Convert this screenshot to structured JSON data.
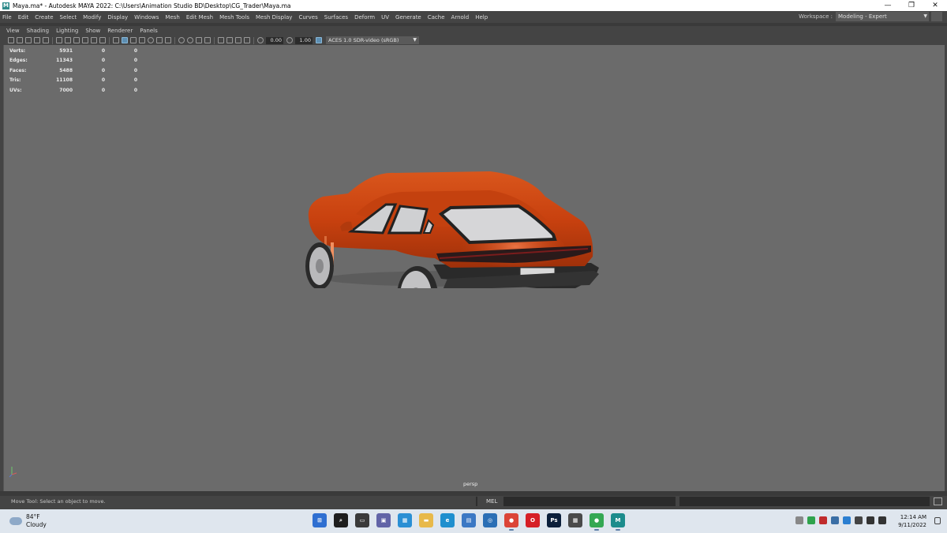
{
  "window": {
    "title": "Maya.ma* - Autodesk MAYA 2022: C:\\Users\\Animation Studio BD\\Desktop\\CG_Trader\\Maya.ma",
    "logo": "M",
    "minimize": "—",
    "maximize": "❐",
    "close": "✕"
  },
  "menubar": {
    "items": [
      "File",
      "Edit",
      "Create",
      "Select",
      "Modify",
      "Display",
      "Windows",
      "Mesh",
      "Edit Mesh",
      "Mesh Tools",
      "Mesh Display",
      "Curves",
      "Surfaces",
      "Deform",
      "UV",
      "Generate",
      "Cache",
      "Arnold",
      "Help"
    ],
    "workspace_label": "Workspace :",
    "workspace_value": "Modeling - Expert"
  },
  "panel": {
    "menus": [
      "View",
      "Shading",
      "Lighting",
      "Show",
      "Renderer",
      "Panels"
    ],
    "exposure": "0.00",
    "gamma": "1.00",
    "color_space": "ACES 1.0 SDR-video (sRGB)"
  },
  "hud": {
    "rows": [
      {
        "label": "Verts:",
        "values": [
          "5931",
          "0",
          "0"
        ]
      },
      {
        "label": "Edges:",
        "values": [
          "11343",
          "0",
          "0"
        ]
      },
      {
        "label": "Faces:",
        "values": [
          "5488",
          "0",
          "0"
        ]
      },
      {
        "label": "Tris:",
        "values": [
          "11108",
          "0",
          "0"
        ]
      },
      {
        "label": "UVs:",
        "values": [
          "7000",
          "0",
          "0"
        ]
      }
    ]
  },
  "viewport": {
    "camera": "persp",
    "background": "#6b6b6b",
    "car_color": "#c8410f"
  },
  "helpline": {
    "message": "Move Tool: Select an object to move.",
    "mel_label": "MEL"
  },
  "taskbar": {
    "temperature": "84°F",
    "condition": "Cloudy",
    "time": "12:14 AM",
    "date": "9/11/2022",
    "apps": [
      {
        "name": "windows-start-icon",
        "color": "#2f6fd1",
        "glyph": "⊞",
        "active": false
      },
      {
        "name": "search-icon",
        "color": "#1e1e1e",
        "glyph": "⌕",
        "active": false
      },
      {
        "name": "task-view-icon",
        "color": "#3a3a3a",
        "glyph": "▭",
        "active": false
      },
      {
        "name": "teams-chat-icon",
        "color": "#6264a7",
        "glyph": "▣",
        "active": false
      },
      {
        "name": "photos-icon",
        "color": "#2a8fd4",
        "glyph": "▦",
        "active": false
      },
      {
        "name": "file-explorer-icon",
        "color": "#e8b94a",
        "glyph": "▬",
        "active": false
      },
      {
        "name": "edge-icon",
        "color": "#1f8fce",
        "glyph": "e",
        "active": false
      },
      {
        "name": "store-icon",
        "color": "#3b78c4",
        "glyph": "▤",
        "active": false
      },
      {
        "name": "cortana-icon",
        "color": "#2b6fb5",
        "glyph": "◎",
        "active": false
      },
      {
        "name": "chrome-icon",
        "color": "#db4437",
        "glyph": "●",
        "active": true
      },
      {
        "name": "opera-icon",
        "color": "#d61f26",
        "glyph": "O",
        "active": false
      },
      {
        "name": "photoshop-icon",
        "color": "#0b1f3a",
        "glyph": "Ps",
        "active": false
      },
      {
        "name": "calculator-icon",
        "color": "#4a4a4a",
        "glyph": "▦",
        "active": false
      },
      {
        "name": "chrome-profile-icon",
        "color": "#34a853",
        "glyph": "●",
        "active": true
      },
      {
        "name": "maya-icon",
        "color": "#1c8c8c",
        "glyph": "M",
        "active": true
      }
    ]
  }
}
